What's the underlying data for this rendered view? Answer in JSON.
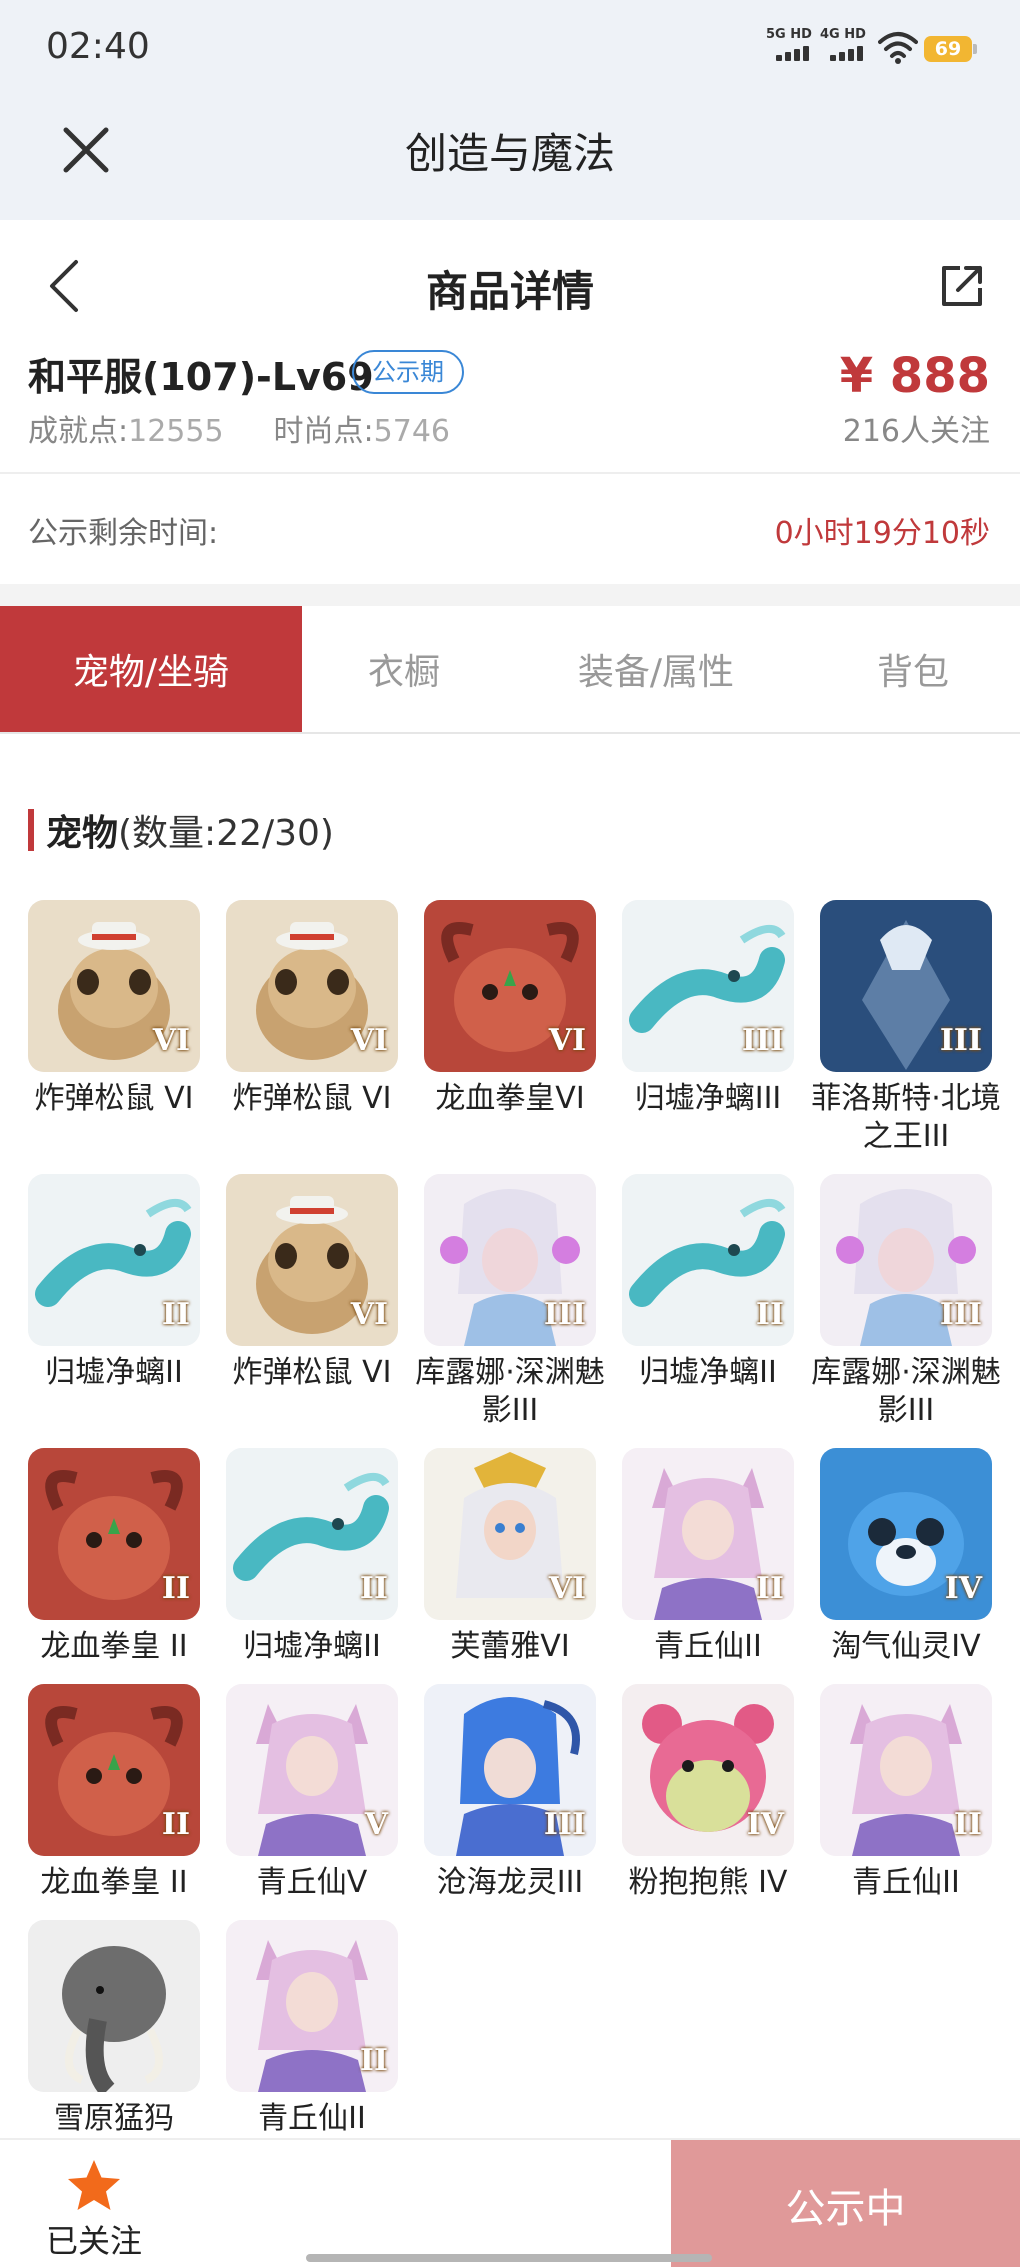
{
  "status_bar": {
    "time": "02:40",
    "signal1": "5G HD",
    "signal2": "4G HD",
    "battery": "69"
  },
  "app": {
    "title": "创造与魔法"
  },
  "page": {
    "title": "商品详情"
  },
  "account": {
    "name": "和平服(107)-Lv69",
    "badge": "公示期",
    "achievement_label": "成就点:",
    "achievement_value": "12555",
    "fashion_label": "时尚点:",
    "fashion_value": "5746",
    "price": "¥ 888",
    "followers": "216人关注"
  },
  "notice": {
    "label": "公示剩余时间:",
    "value": "0小时19分10秒"
  },
  "tabs": [
    {
      "label": "宠物/坐骑",
      "active": true
    },
    {
      "label": "衣橱",
      "active": false
    },
    {
      "label": "装备/属性",
      "active": false
    },
    {
      "label": "背包",
      "active": false
    }
  ],
  "pets_section": {
    "title": "宠物",
    "count": "(数量:22/30)"
  },
  "pets": [
    {
      "name": "炸弹松鼠 VI",
      "level": "VI",
      "icon": "squirrel-icon"
    },
    {
      "name": "炸弹松鼠 VI",
      "level": "VI",
      "icon": "squirrel-icon"
    },
    {
      "name": "龙血拳皇VI",
      "level": "VI",
      "icon": "dragon-blood-brawler-icon"
    },
    {
      "name": "归墟净螭III",
      "level": "III",
      "icon": "teal-dragon-icon"
    },
    {
      "name": "菲洛斯特·北境之王III",
      "level": "III",
      "icon": "frost-king-icon"
    },
    {
      "name": "归墟净螭II",
      "level": "II",
      "icon": "teal-dragon-icon"
    },
    {
      "name": "炸弹松鼠 VI",
      "level": "VI",
      "icon": "squirrel-icon"
    },
    {
      "name": "库露娜·深渊魅影III",
      "level": "III",
      "icon": "abyss-phantom-icon"
    },
    {
      "name": "归墟净螭II",
      "level": "II",
      "icon": "teal-dragon-icon"
    },
    {
      "name": "库露娜·深渊魅影III",
      "level": "III",
      "icon": "abyss-phantom-icon"
    },
    {
      "name": "龙血拳皇 II",
      "level": "II",
      "icon": "dragon-blood-brawler-icon"
    },
    {
      "name": "归墟净螭II",
      "level": "II",
      "icon": "teal-dragon-icon"
    },
    {
      "name": "芙蕾雅VI",
      "level": "VI",
      "icon": "golden-valkyrie-icon"
    },
    {
      "name": "青丘仙II",
      "level": "II",
      "icon": "fox-fairy-icon"
    },
    {
      "name": "淘气仙灵IV",
      "level": "IV",
      "icon": "blue-puppy-icon"
    },
    {
      "name": "龙血拳皇 II",
      "level": "II",
      "icon": "dragon-blood-brawler-icon"
    },
    {
      "name": "青丘仙V",
      "level": "V",
      "icon": "fox-fairy-icon"
    },
    {
      "name": "沧海龙灵III",
      "level": "III",
      "icon": "sea-dragon-spirit-icon"
    },
    {
      "name": "粉抱抱熊 IV",
      "level": "IV",
      "icon": "pink-bear-icon"
    },
    {
      "name": "青丘仙II",
      "level": "II",
      "icon": "fox-fairy-icon"
    },
    {
      "name": "雪原猛犸",
      "level": "",
      "icon": "mammoth-icon"
    },
    {
      "name": "青丘仙II",
      "level": "II",
      "icon": "fox-fairy-icon"
    }
  ],
  "bottom_bar": {
    "follow_label": "已关注",
    "status_button": "公示中"
  },
  "colors": {
    "accent": "#c0393b",
    "badge_blue": "#3a87d6",
    "status_button_bg": "#e09999",
    "header_bg": "#eef2f7",
    "star": "#f26a1b"
  }
}
